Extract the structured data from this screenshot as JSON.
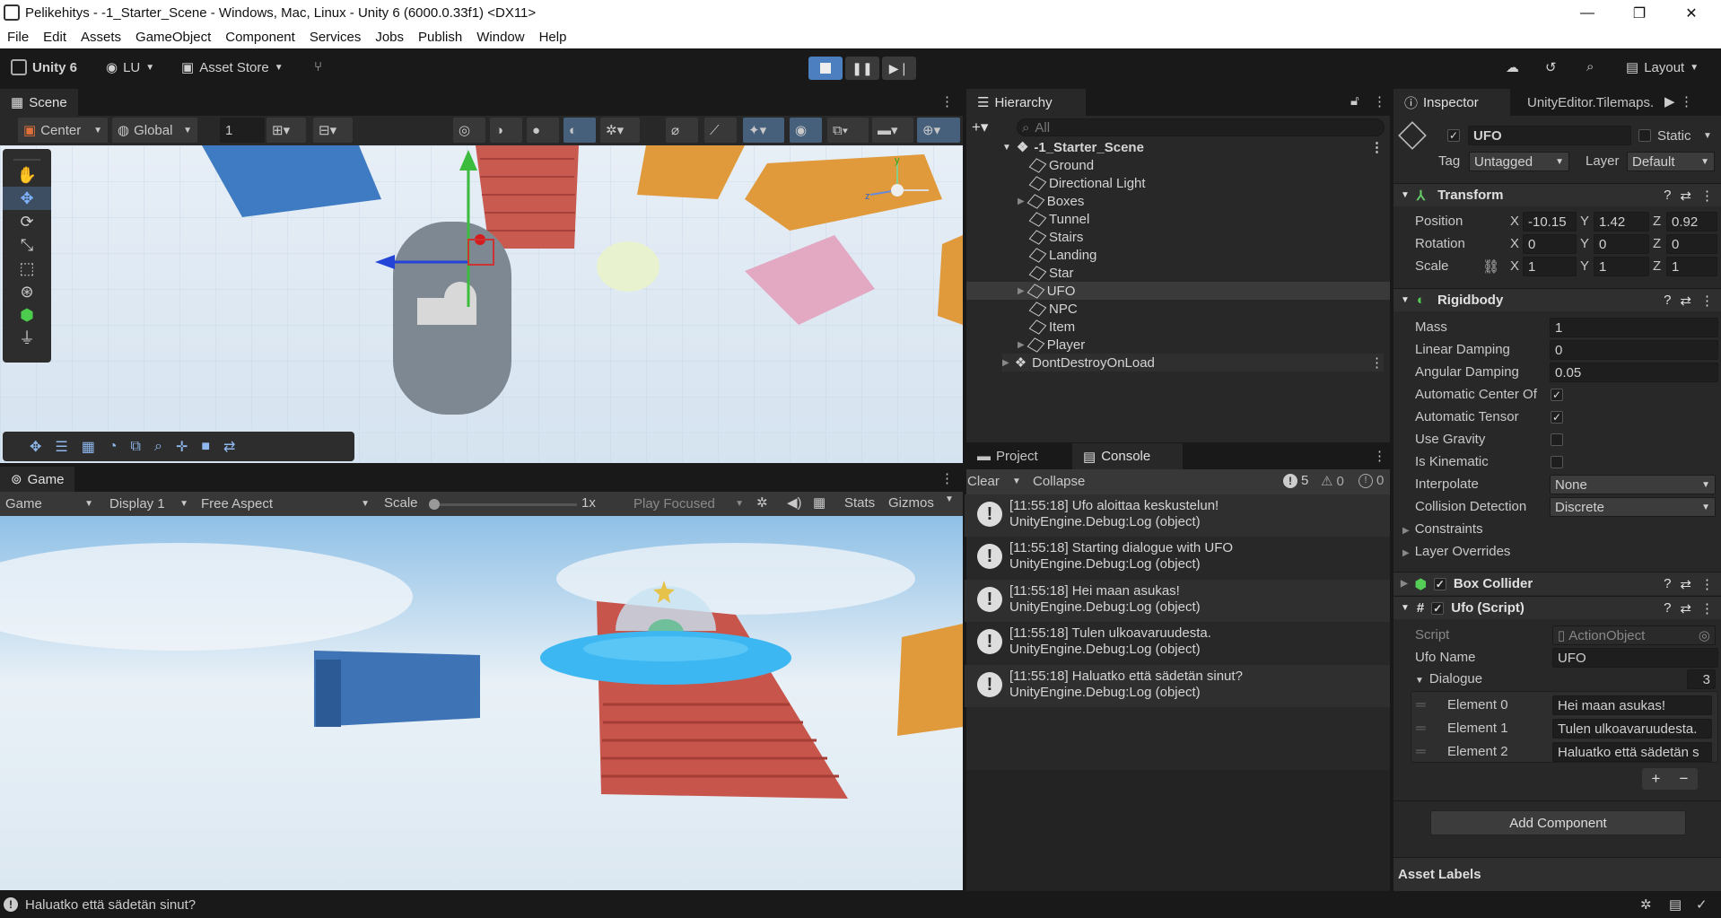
{
  "window": {
    "title": "Pelikehitys - -1_Starter_Scene - Windows, Mac, Linux - Unity 6 (6000.0.33f1) <DX11>",
    "minimize": "—",
    "maximize": "❐",
    "close": "✕"
  },
  "menu": [
    "File",
    "Edit",
    "Assets",
    "GameObject",
    "Component",
    "Services",
    "Jobs",
    "Publish",
    "Window",
    "Help"
  ],
  "toolbar": {
    "product": "Unity 6",
    "account": "LU",
    "asset_store": "Asset Store",
    "layout": "Layout"
  },
  "scene": {
    "tab": "Scene",
    "pivot": "Center",
    "space": "Global",
    "snap_value": "1"
  },
  "game": {
    "tab": "Game",
    "mode": "Game",
    "display": "Display 1",
    "aspect": "Free Aspect",
    "scale_label": "Scale",
    "scale_value": "1x",
    "play_focused": "Play Focused",
    "stats": "Stats",
    "gizmos": "Gizmos"
  },
  "hierarchy": {
    "tab": "Hierarchy",
    "search_placeholder": "All",
    "scene": "-1_Starter_Scene",
    "items": [
      "Ground",
      "Directional Light",
      "Boxes",
      "Tunnel",
      "Stairs",
      "Landing",
      "Star",
      "UFO",
      "NPC",
      "Item",
      "Player"
    ],
    "dont_destroy": "DontDestroyOnLoad"
  },
  "bottom_tabs": {
    "project": "Project",
    "console": "Console"
  },
  "console": {
    "clear": "Clear",
    "collapse": "Collapse",
    "count_log": "5",
    "count_warn": "0",
    "count_err": "0",
    "logs": [
      {
        "msg": "[11:55:18] Ufo aloittaa keskustelun!",
        "src": "UnityEngine.Debug:Log (object)"
      },
      {
        "msg": "[11:55:18] Starting dialogue with UFO",
        "src": "UnityEngine.Debug:Log (object)"
      },
      {
        "msg": "[11:55:18] Hei maan asukas!",
        "src": "UnityEngine.Debug:Log (object)"
      },
      {
        "msg": "[11:55:18] Tulen ulkoavaruudesta.",
        "src": "UnityEngine.Debug:Log (object)"
      },
      {
        "msg": "[11:55:18] Haluatko että sädetän sinut?",
        "src": "UnityEngine.Debug:Log (object)"
      }
    ]
  },
  "inspector": {
    "tab": "Inspector",
    "tab2": "UnityEditor.Tilemaps.",
    "object_name": "UFO",
    "static_label": "Static",
    "tag_label": "Tag",
    "tag_value": "Untagged",
    "layer_label": "Layer",
    "layer_value": "Default",
    "transform": {
      "title": "Transform",
      "position_label": "Position",
      "rotation_label": "Rotation",
      "scale_label": "Scale",
      "pos": {
        "x": "-10.15",
        "y": "1.42",
        "z": "0.92"
      },
      "rot": {
        "x": "0",
        "y": "0",
        "z": "0"
      },
      "scl": {
        "x": "1",
        "y": "1",
        "z": "1"
      },
      "axis_x": "X",
      "axis_y": "Y",
      "axis_z": "Z"
    },
    "rigidbody": {
      "title": "Rigidbody",
      "mass_label": "Mass",
      "mass": "1",
      "lin_damp_label": "Linear Damping",
      "lin_damp": "0",
      "ang_damp_label": "Angular Damping",
      "ang_damp": "0.05",
      "auto_center_label": "Automatic Center Of",
      "auto_tensor_label": "Automatic Tensor",
      "use_gravity_label": "Use Gravity",
      "kinematic_label": "Is Kinematic",
      "interpolate_label": "Interpolate",
      "interpolate": "None",
      "collision_label": "Collision Detection",
      "collision": "Discrete",
      "constraints": "Constraints",
      "layer_overrides": "Layer Overrides"
    },
    "box_collider": "Box Collider",
    "ufo_script": {
      "title": "Ufo (Script)",
      "script_label": "Script",
      "script_value": "ActionObject",
      "ufo_name_label": "Ufo Name",
      "ufo_name": "UFO",
      "dialogue_label": "Dialogue",
      "dialogue_count": "3",
      "elements": [
        {
          "label": "Element 0",
          "value": "Hei maan asukas!"
        },
        {
          "label": "Element 1",
          "value": "Tulen ulkoavaruudesta."
        },
        {
          "label": "Element 2",
          "value": "Haluatko että sädetän s"
        }
      ]
    },
    "add_component": "Add Component",
    "asset_labels": "Asset Labels"
  },
  "statusbar": {
    "message": "Haluatko että sädetän sinut?"
  },
  "colors": {
    "accent": "#4c7fc0",
    "panel": "#282828",
    "dark": "#191919",
    "sky": "#dfe9f3"
  }
}
